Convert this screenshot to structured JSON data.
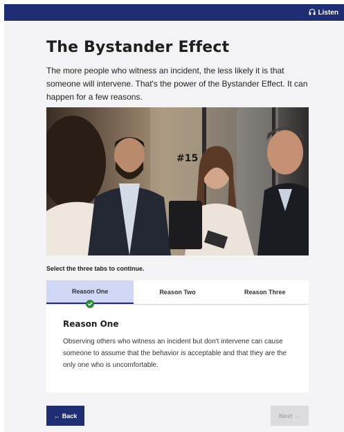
{
  "header": {
    "listen_label": "Listen",
    "listen_icon": "headphones-icon",
    "background": "#1f2d72"
  },
  "page": {
    "title": "The Bystander Effect",
    "intro": "The more people who witness an incident, the less likely it is that someone will intervene. That's the power of the Bystander Effect. It can happen for a few reasons.",
    "instruction": "Select the three tabs to continue."
  },
  "tabs": [
    {
      "label": "Reason One",
      "active": true,
      "completed": true
    },
    {
      "label": "Reason Two",
      "active": false,
      "completed": false
    },
    {
      "label": "Reason Three",
      "active": false,
      "completed": false
    }
  ],
  "panel": {
    "title": "Reason One",
    "body": "Observing others who witness an incident but don't intervene can cause someone to assume that the behavior is acceptable and that they are the only one who is uncomfortable."
  },
  "photo": {
    "sign_text": "#15"
  },
  "nav": {
    "back_label": "Back",
    "back_icon": "arrow-left-icon",
    "next_label": "Next",
    "next_icon": "arrow-right-icon",
    "next_enabled": false
  },
  "colors": {
    "accent": "#1f2d72",
    "active_tab": "#cfd7f5",
    "check": "#2f8a3c"
  }
}
